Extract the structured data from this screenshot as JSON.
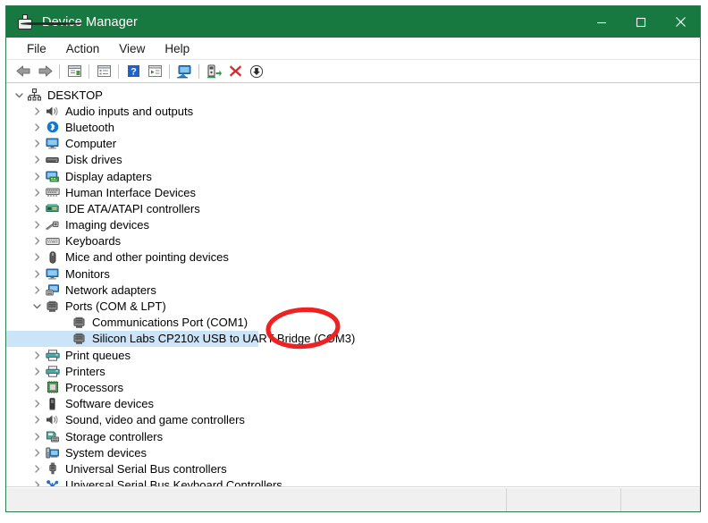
{
  "window": {
    "title": "Device Manager",
    "title_icon": "device-chip-icon",
    "accent_color": "#17793f",
    "selection_color": "#cce4f7",
    "annotation_color": "#ee2222",
    "buttons": [
      {
        "name": "minimize-button",
        "glyph": "minimize"
      },
      {
        "name": "maximize-button",
        "glyph": "maximize"
      },
      {
        "name": "close-button",
        "glyph": "close"
      }
    ]
  },
  "menubar": {
    "items": [
      {
        "label": "File",
        "name": "menu-file"
      },
      {
        "label": "Action",
        "name": "menu-action"
      },
      {
        "label": "View",
        "name": "menu-view"
      },
      {
        "label": "Help",
        "name": "menu-help"
      }
    ]
  },
  "toolbar": {
    "items": [
      {
        "name": "back-button",
        "icon": "back-arrow-icon",
        "type": "button"
      },
      {
        "name": "forward-button",
        "icon": "forward-arrow-icon",
        "type": "button"
      },
      {
        "type": "separator"
      },
      {
        "name": "properties-button",
        "icon": "properties-icon",
        "type": "button"
      },
      {
        "type": "separator"
      },
      {
        "name": "show-hidden-devices-button",
        "icon": "list-view-icon",
        "type": "button"
      },
      {
        "type": "separator"
      },
      {
        "name": "help-button",
        "icon": "help-question-icon",
        "type": "button"
      },
      {
        "name": "device-details-button",
        "icon": "device-panel-icon",
        "type": "button"
      },
      {
        "type": "separator"
      },
      {
        "name": "scan-hardware-changes-button",
        "icon": "monitor-scan-icon",
        "type": "button"
      },
      {
        "type": "separator"
      },
      {
        "name": "update-driver-button",
        "icon": "update-driver-icon",
        "type": "button"
      },
      {
        "name": "uninstall-device-button",
        "icon": "red-x-icon",
        "type": "button"
      },
      {
        "name": "disable-device-button",
        "icon": "down-arrow-circle-icon",
        "type": "button"
      }
    ]
  },
  "tree": {
    "root": {
      "label": "DESKTOP",
      "icon": "computer-root-icon",
      "expanded": true
    },
    "nodes": [
      {
        "label": "Audio inputs and outputs",
        "icon": "speaker-icon",
        "depth": 1,
        "state": "collapsed"
      },
      {
        "label": "Bluetooth",
        "icon": "bluetooth-icon",
        "depth": 1,
        "state": "collapsed"
      },
      {
        "label": "Computer",
        "icon": "monitor-icon",
        "depth": 1,
        "state": "collapsed"
      },
      {
        "label": "Disk drives",
        "icon": "disk-drive-icon",
        "depth": 1,
        "state": "collapsed"
      },
      {
        "label": "Display adapters",
        "icon": "display-adapter-icon",
        "depth": 1,
        "state": "collapsed"
      },
      {
        "label": "Human Interface Devices",
        "icon": "hid-keyboard-icon",
        "depth": 1,
        "state": "collapsed"
      },
      {
        "label": "IDE ATA/ATAPI controllers",
        "icon": "ide-controller-icon",
        "depth": 1,
        "state": "collapsed"
      },
      {
        "label": "Imaging devices",
        "icon": "imaging-device-icon",
        "depth": 1,
        "state": "collapsed"
      },
      {
        "label": "Keyboards",
        "icon": "keyboard-icon",
        "depth": 1,
        "state": "collapsed"
      },
      {
        "label": "Mice and other pointing devices",
        "icon": "mouse-icon",
        "depth": 1,
        "state": "collapsed"
      },
      {
        "label": "Monitors",
        "icon": "monitor-icon",
        "depth": 1,
        "state": "collapsed"
      },
      {
        "label": "Network adapters",
        "icon": "network-adapter-icon",
        "depth": 1,
        "state": "collapsed"
      },
      {
        "label": "Ports (COM & LPT)",
        "icon": "port-icon",
        "depth": 1,
        "state": "expanded"
      },
      {
        "label": "Communications Port (COM1)",
        "icon": "port-icon",
        "depth": 2,
        "state": "leaf"
      },
      {
        "label": "Silicon Labs CP210x USB to UART Bridge (COM3)",
        "icon": "port-icon",
        "depth": 2,
        "state": "leaf",
        "selected": true
      },
      {
        "label": "Print queues",
        "icon": "printer-icon",
        "depth": 1,
        "state": "collapsed"
      },
      {
        "label": "Printers",
        "icon": "printer-icon",
        "depth": 1,
        "state": "collapsed"
      },
      {
        "label": "Processors",
        "icon": "processor-icon",
        "depth": 1,
        "state": "collapsed"
      },
      {
        "label": "Software devices",
        "icon": "software-device-icon",
        "depth": 1,
        "state": "collapsed"
      },
      {
        "label": "Sound, video and game controllers",
        "icon": "speaker-icon",
        "depth": 1,
        "state": "collapsed"
      },
      {
        "label": "Storage controllers",
        "icon": "storage-controller-icon",
        "depth": 1,
        "state": "collapsed"
      },
      {
        "label": "System devices",
        "icon": "system-device-icon",
        "depth": 1,
        "state": "collapsed"
      },
      {
        "label": "Universal Serial Bus controllers",
        "icon": "usb-icon",
        "depth": 1,
        "state": "collapsed"
      },
      {
        "label": "Universal Serial Bus Keyboard Controllers",
        "icon": "usb-keyboard-icon",
        "depth": 1,
        "state": "collapsed"
      }
    ]
  },
  "annotation": {
    "name": "red-circle-highlight",
    "target_text": "(COM3)",
    "color": "#ee2222",
    "shape": "ellipse"
  },
  "statusbar": {
    "panes": [
      "",
      "",
      ""
    ]
  }
}
